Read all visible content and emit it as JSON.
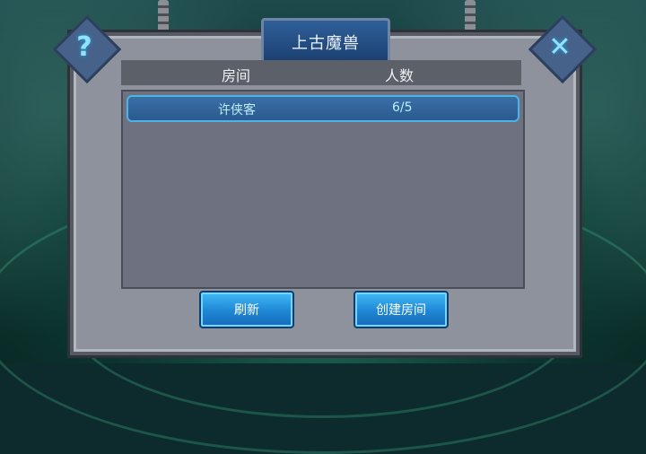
{
  "window": {
    "title": "上古魔兽"
  },
  "corners": {
    "help_symbol": "?",
    "close_symbol": "✕"
  },
  "table": {
    "headers": {
      "room": "房间",
      "players": "人数"
    },
    "rows": [
      {
        "room": "许侠客",
        "players": "6/5"
      }
    ]
  },
  "actions": {
    "refresh": "刷新",
    "create_room": "创建房间"
  },
  "icons": {
    "help": "help-icon",
    "close": "close-icon"
  },
  "colors": {
    "panel": "#8e929c",
    "button": "#1f86d6",
    "selected_row_border": "#4fb3e6"
  }
}
